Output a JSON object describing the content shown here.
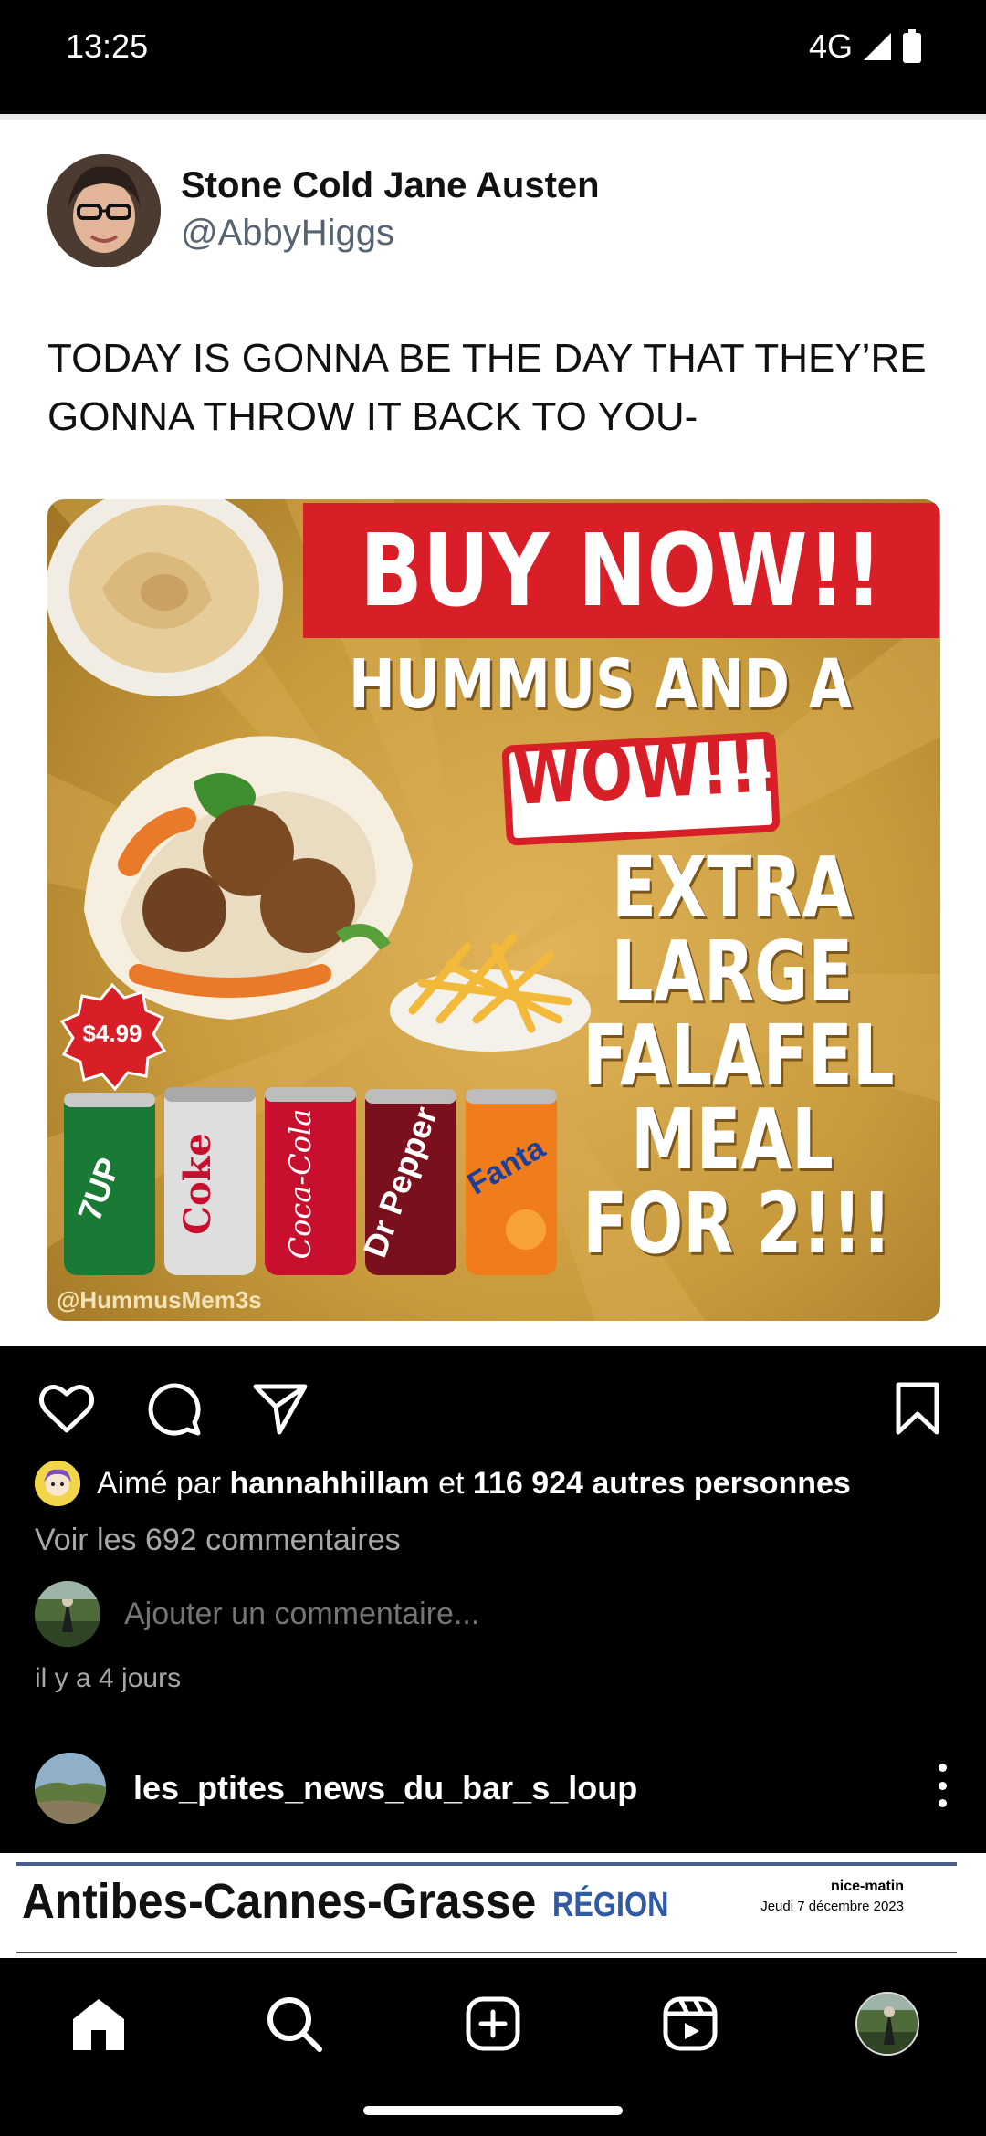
{
  "status_bar": {
    "time": "13:25",
    "network": "4G",
    "icons": [
      "signal-icon",
      "battery-icon"
    ]
  },
  "tweet": {
    "name": "Stone Cold Jane Austen",
    "handle": "@AbbyHiggs",
    "text": "TODAY IS GONNA BE THE DAY THAT THEY’RE GONNA THROW IT BACK TO YOU-"
  },
  "promo": {
    "headline": "BUY NOW!!",
    "line2": "HUMMUS AND A",
    "wow": "WOW!!!",
    "offer_lines": [
      "EXTRA",
      "LARGE",
      "FALAFEL",
      "MEAL",
      "FOR 2!!!"
    ],
    "price": "$4.99",
    "watermark": "@HummusMem3s",
    "cans": [
      {
        "label": "7UP",
        "color": "#1a7a35"
      },
      {
        "label": "Diet Coke",
        "color": "#d9d9d9"
      },
      {
        "label": "Coca-Cola",
        "color": "#c8102e"
      },
      {
        "label": "Dr Pepper",
        "color": "#7a0f1d"
      },
      {
        "label": "Fanta",
        "color": "#f07d1a"
      }
    ],
    "colors": {
      "red": "#d81e26",
      "background": "#c79a3c"
    }
  },
  "actions": {
    "icons": [
      "heart-icon",
      "comment-icon",
      "share-icon",
      "bookmark-icon"
    ]
  },
  "likes": {
    "prefix": "Aimé par",
    "user": "hannahhillam",
    "connector": "et",
    "count": "116 924 autres personnes"
  },
  "comments": {
    "view_all": "Voir les 692 commentaires",
    "placeholder": "Ajouter un commentaire...",
    "timestamp": "il y a 4 jours"
  },
  "next_post": {
    "username": "les_ptites_news_du_bar_s_loup",
    "image": {
      "title": "Antibes-Cannes-Grasse",
      "region": "RÉGION",
      "brand": "nice-matin",
      "date": "Jeudi 7 décembre 2023"
    }
  },
  "bottom_nav": {
    "items": [
      "home-icon",
      "search-icon",
      "create-icon",
      "reels-icon",
      "profile-avatar"
    ]
  }
}
